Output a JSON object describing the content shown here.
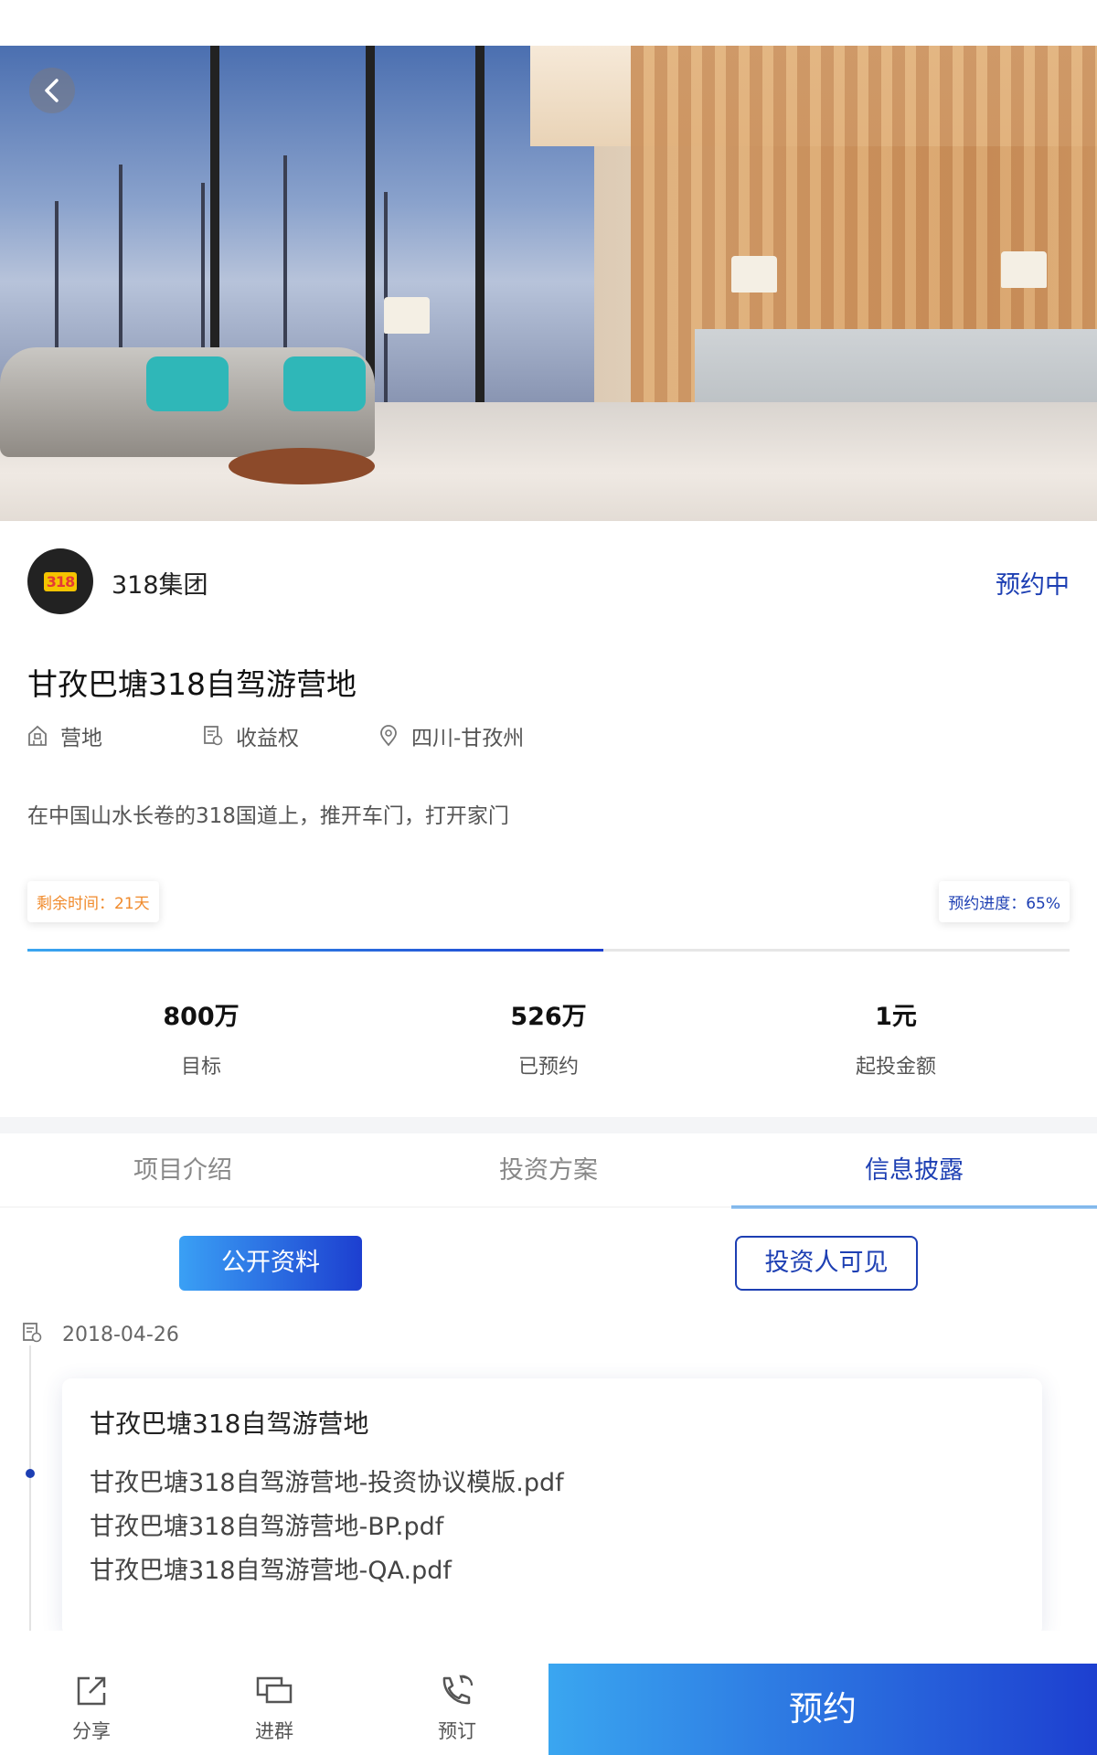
{
  "org": {
    "logo_text": "318",
    "name": "318集团",
    "status": "预约中"
  },
  "project": {
    "title": "甘孜巴塘318自驾游营地",
    "category": "营地",
    "right_type": "收益权",
    "location": "四川-甘孜州",
    "description": "在中国山水长卷的318国道上，推开车门，打开家门"
  },
  "progress": {
    "remaining_label": "剩余时间：21天",
    "progress_label": "预约进度：65%",
    "percent": 65
  },
  "stats": [
    {
      "value": "800万",
      "label": "目标"
    },
    {
      "value": "526万",
      "label": "已预约"
    },
    {
      "value": "1元",
      "label": "起投金额"
    }
  ],
  "tabs": [
    {
      "label": "项目介绍",
      "active": false
    },
    {
      "label": "投资方案",
      "active": false
    },
    {
      "label": "信息披露",
      "active": true
    }
  ],
  "filters": {
    "public": "公开资料",
    "investor": "投资人可见"
  },
  "disclosure": {
    "date": "2018-04-26",
    "title": "甘孜巴塘318自驾游营地",
    "files": [
      "甘孜巴塘318自驾游营地-投资协议模版.pdf",
      "甘孜巴塘318自驾游营地-BP.pdf",
      "甘孜巴塘318自驾游营地-QA.pdf"
    ]
  },
  "bottom_bar": {
    "share": "分享",
    "group": "进群",
    "call": "预订",
    "reserve": "预约"
  },
  "colors": {
    "brand_blue": "#1d3fb3",
    "accent_gradient_start": "#3aa6f0",
    "orange": "#f08a2b"
  }
}
